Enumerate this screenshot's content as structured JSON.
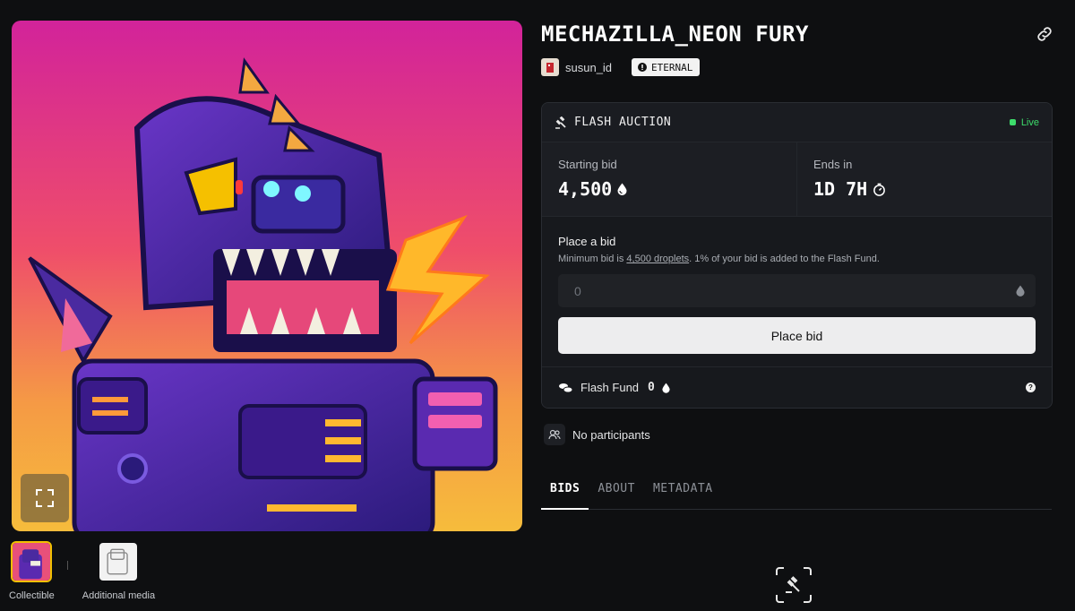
{
  "nft": {
    "title": "MECHAZILLA_NEON FURY",
    "creator": "susun_id",
    "badge": "ETERNAL"
  },
  "media": {
    "thumbnails": [
      {
        "caption": "Collectible",
        "active": true
      },
      {
        "caption": "Additional media",
        "active": false
      }
    ]
  },
  "auction": {
    "header": "FLASH AUCTION",
    "status": "Live",
    "starting_bid_label": "Starting bid",
    "starting_bid_value": "4,500",
    "ends_label": "Ends in",
    "ends_value": "1D 7H",
    "place_bid_heading": "Place a bid",
    "min_bid_prefix": "Minimum bid is ",
    "min_bid_amount": "4,500 droplets",
    "min_bid_suffix": ". 1% of your bid is added to the Flash Fund.",
    "bid_input_placeholder": "0",
    "place_bid_button": "Place bid",
    "flash_fund_label": "Flash Fund",
    "flash_fund_value": "0"
  },
  "participants_text": "No participants",
  "tabs": [
    {
      "label": "BIDS",
      "active": true
    },
    {
      "label": "ABOUT",
      "active": false
    },
    {
      "label": "METADATA",
      "active": false
    }
  ],
  "colors": {
    "accent_live": "#3ddc6b",
    "background": "#0e0f11",
    "thumb_active_border": "#f0c000"
  }
}
